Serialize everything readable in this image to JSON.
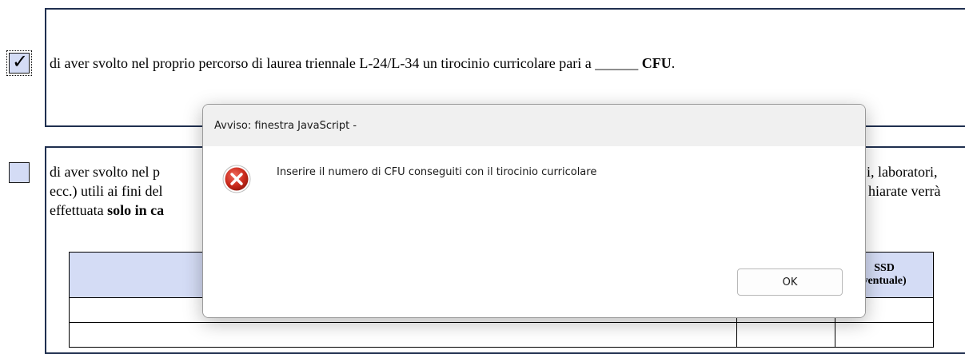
{
  "section1": {
    "checked": true,
    "text_before": "di aver svolto nel proprio percorso di laurea triennale L-24/L-34 un tirocinio curricolare pari a ",
    "blank": "______",
    "bold_cfu": "CFU",
    "period": "."
  },
  "section2": {
    "checked": false,
    "line1_left": "di aver svolto nel p",
    "line1_right": "i, laboratori,",
    "line2_left": "ecc.) utili ai fini del",
    "line2_right": "hiarate verrà",
    "line3_prefix": "effettuata ",
    "line3_bold": "solo in ca"
  },
  "table": {
    "col_ssd_line1": "SSD",
    "col_ssd_line2": "ventuale)"
  },
  "dialog": {
    "title": "Avviso: finestra JavaScript -",
    "message": "Inserire il numero di CFU conseguiti con il tirocinio curricolare",
    "ok_label": "OK",
    "icon": "error-icon",
    "icon_color": "#c42b1c"
  }
}
